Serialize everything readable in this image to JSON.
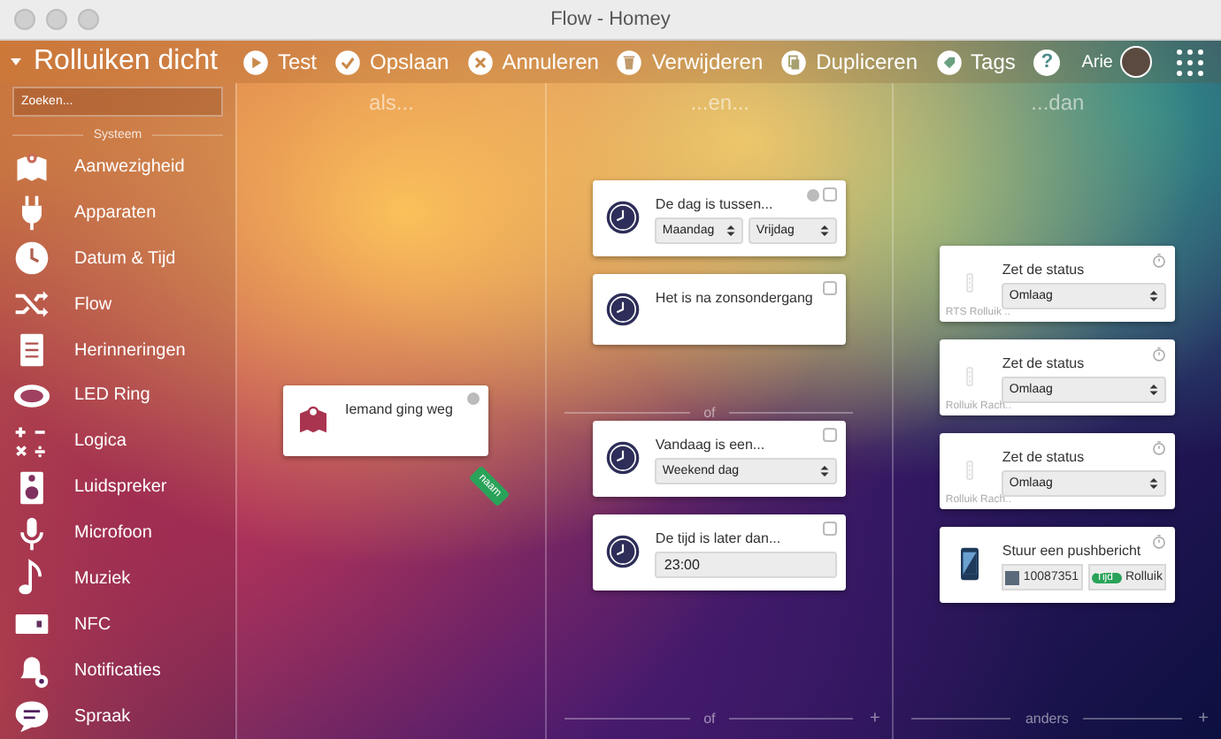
{
  "window": {
    "title": "Flow - Homey"
  },
  "toolbar": {
    "flow_name": "Rolluiken dicht",
    "actions": [
      {
        "kind": "test",
        "label": "Test"
      },
      {
        "kind": "save",
        "label": "Opslaan"
      },
      {
        "kind": "cancel",
        "label": "Annuleren"
      },
      {
        "kind": "delete",
        "label": "Verwijderen"
      },
      {
        "kind": "duplicate",
        "label": "Dupliceren"
      },
      {
        "kind": "tags",
        "label": "Tags"
      }
    ],
    "help": "?",
    "user": "Arie"
  },
  "sidebar": {
    "search": {
      "placeholder": "Zoeken..."
    },
    "section": "Systeem",
    "items": [
      {
        "label": "Aanwezigheid"
      },
      {
        "label": "Apparaten"
      },
      {
        "label": "Datum & Tijd"
      },
      {
        "label": "Flow"
      },
      {
        "label": "Herinneringen"
      },
      {
        "label": "LED Ring"
      },
      {
        "label": "Logica"
      },
      {
        "label": "Luidspreker"
      },
      {
        "label": "Microfoon"
      },
      {
        "label": "Muziek"
      },
      {
        "label": "NFC"
      },
      {
        "label": "Notificaties"
      },
      {
        "label": "Spraak"
      }
    ]
  },
  "columns": [
    {
      "kind": "when",
      "heading": "als...",
      "groups": [
        {
          "cards": [
            {
              "kind": "trigger",
              "title": "Iemand ging weg",
              "info": true,
              "tag": "naam"
            }
          ]
        }
      ]
    },
    {
      "kind": "and",
      "heading": "...en...",
      "groups": [
        {
          "cards": [
            {
              "kind": "condition",
              "title": "De dag is tussen...",
              "info": true,
              "checked": false,
              "fields": [
                {
                  "kind": "select",
                  "value": "Maandag"
                },
                {
                  "kind": "select",
                  "value": "Vrijdag"
                }
              ]
            },
            {
              "kind": "condition",
              "title": "Het is na zonsondergang",
              "info": false,
              "checked": false
            }
          ],
          "divider": {
            "label": "of"
          }
        },
        {
          "cards": [
            {
              "kind": "condition",
              "title": "Vandaag is een...",
              "info": false,
              "checked": false,
              "fields": [
                {
                  "kind": "select",
                  "value": "Weekend dag"
                }
              ]
            },
            {
              "kind": "condition",
              "title": "De tijd is later dan...",
              "info": false,
              "checked": false,
              "fields": [
                {
                  "kind": "input",
                  "value": "23:00"
                }
              ]
            }
          ],
          "divider": {
            "label": "of",
            "add": "+"
          }
        }
      ]
    },
    {
      "kind": "then",
      "heading": "...dan",
      "groups": [
        {
          "cards": [
            {
              "kind": "device",
              "device": "RTS Rolluik ..",
              "title": "Zet de status",
              "fields": [
                {
                  "kind": "select",
                  "value": "Omlaag"
                }
              ]
            },
            {
              "kind": "device",
              "device": "Rolluik Rach..",
              "title": "Zet de status",
              "fields": [
                {
                  "kind": "select",
                  "value": "Omlaag"
                }
              ]
            },
            {
              "kind": "device",
              "device": "Rolluik Rach..",
              "title": "Zet de status",
              "fields": [
                {
                  "kind": "select",
                  "value": "Omlaag"
                }
              ]
            },
            {
              "kind": "push",
              "title": "Stuur een pushbericht",
              "fields": [
                {
                  "kind": "user",
                  "value": "10087351"
                },
                {
                  "kind": "token",
                  "token": "Tijd",
                  "value": "Rolluik"
                }
              ]
            }
          ],
          "divider": {
            "label": "anders",
            "add": "+"
          }
        }
      ]
    }
  ]
}
